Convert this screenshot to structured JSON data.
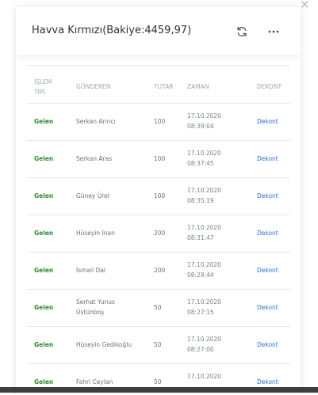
{
  "header": {
    "title": "Havva Kırmızı(Bakiye:4459,97)",
    "refresh_icon": "refresh-icon",
    "more_icon": "more-horizontal-icon"
  },
  "table": {
    "columns": {
      "type_line1": "İŞLEM",
      "type_line2": "TİPİ",
      "sender": "GÖNDEREN",
      "amount": "TUTAR",
      "time": "ZAMAN",
      "receipt": "DEKONT"
    },
    "rows": [
      {
        "type": "Gelen",
        "sender1": "Serkan Arıncı",
        "sender2": "",
        "amount": "100",
        "date": "17.10.2020",
        "time": "08:39:04",
        "receipt": "Dekont"
      },
      {
        "type": "Gelen",
        "sender1": "Serkan Aras",
        "sender2": "",
        "amount": "100",
        "date": "17.10.2020",
        "time": "08:37:45",
        "receipt": "Dekont"
      },
      {
        "type": "Gelen",
        "sender1": "Güney Ürel",
        "sender2": "",
        "amount": "100",
        "date": "17.10.2020",
        "time": "08:35:19",
        "receipt": "Dekont"
      },
      {
        "type": "Gelen",
        "sender1": "Hüseyin İnan",
        "sender2": "",
        "amount": "200",
        "date": "17.10.2020",
        "time": "08:31:47",
        "receipt": "Dekont"
      },
      {
        "type": "Gelen",
        "sender1": "İsmail Dal",
        "sender2": "",
        "amount": "200",
        "date": "17.10.2020",
        "time": "08:28:44",
        "receipt": "Dekont"
      },
      {
        "type": "Gelen",
        "sender1": "Serhat Yunus",
        "sender2": "Üstünboş",
        "amount": "50",
        "date": "17.10.2020",
        "time": "08:27:15",
        "receipt": "Dekont"
      },
      {
        "type": "Gelen",
        "sender1": "Hüseyin Gedikoğlu",
        "sender2": "",
        "amount": "50",
        "date": "17.10.2020",
        "time": "08:27:00",
        "receipt": "Dekont"
      },
      {
        "type": "Gelen",
        "sender1": "Fahri Ceylan",
        "sender2": "",
        "amount": "50",
        "date": "17.10.2020",
        "time": "",
        "receipt": "Dekont"
      }
    ]
  },
  "colors": {
    "incoming": "#2e8b2e",
    "link": "#2f6fd6"
  }
}
